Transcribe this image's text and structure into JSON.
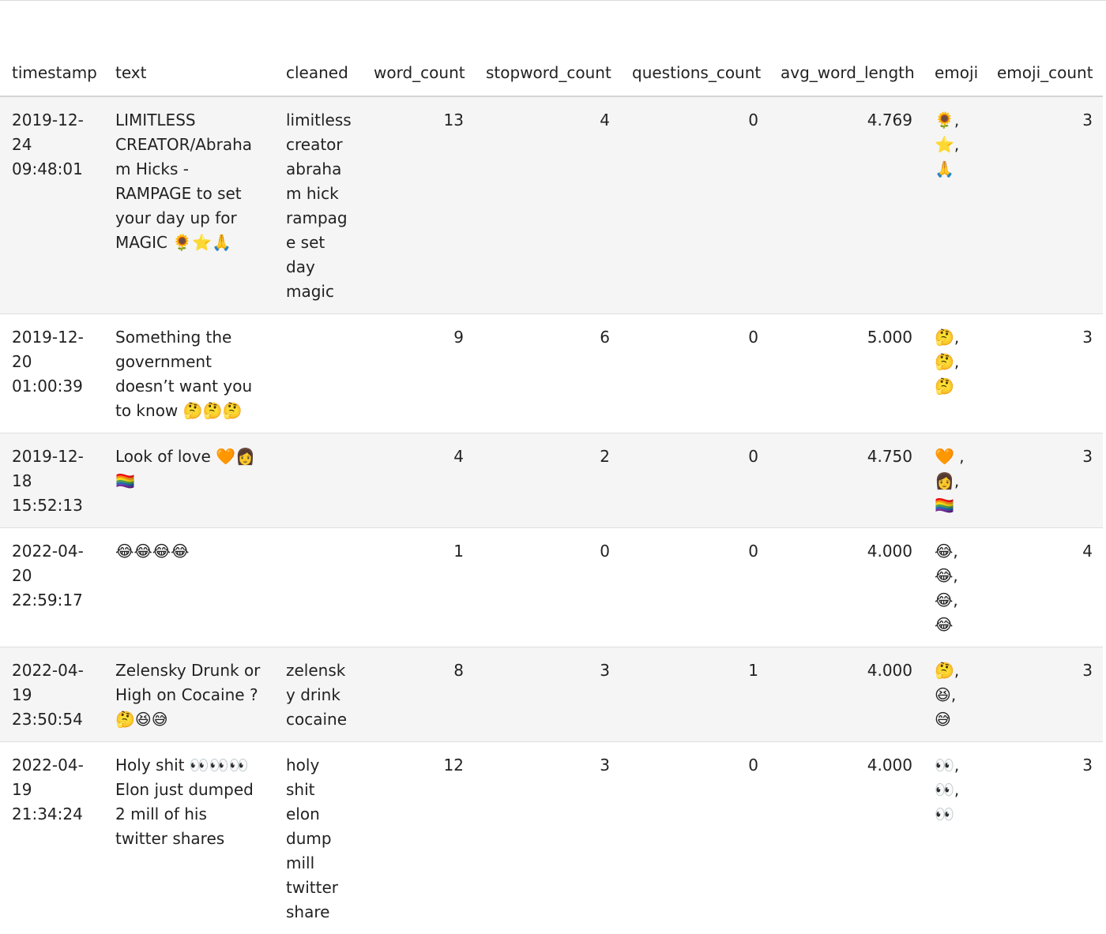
{
  "table": {
    "columns": [
      "timestamp",
      "text",
      "cleaned",
      "word_count",
      "stopword_count",
      "questions_count",
      "avg_word_length",
      "emoji",
      "emoji_count"
    ],
    "rows": [
      {
        "timestamp": "2019-12-24 09:48:01",
        "text": "LIMITLESS CREATOR/Abraham Hicks - RAMPAGE to set your day up for MAGIC 🌻⭐🙏",
        "cleaned": "limitless creator abraham hick rampage set day magic",
        "word_count": "13",
        "stopword_count": "4",
        "questions_count": "0",
        "avg_word_length": "4.769",
        "emoji": "🌻, ⭐, 🙏",
        "emoji_count": "3"
      },
      {
        "timestamp": "2019-12-20 01:00:39",
        "text": "Something the government doesn’t want you to know 🤔🤔🤔",
        "cleaned": "",
        "word_count": "9",
        "stopword_count": "6",
        "questions_count": "0",
        "avg_word_length": "5.000",
        "emoji": "🤔, 🤔, 🤔",
        "emoji_count": "3"
      },
      {
        "timestamp": "2019-12-18 15:52:13",
        "text": "Look of love 🧡👩🏳️‍🌈",
        "cleaned": "",
        "word_count": "4",
        "stopword_count": "2",
        "questions_count": "0",
        "avg_word_length": "4.750",
        "emoji": "🧡 , 👩, 🏳️‍🌈",
        "emoji_count": "3"
      },
      {
        "timestamp": "2022-04-20 22:59:17",
        "text": "😂😂😂😂",
        "cleaned": "",
        "word_count": "1",
        "stopword_count": "0",
        "questions_count": "0",
        "avg_word_length": "4.000",
        "emoji": "😂, 😂, 😂, 😂",
        "emoji_count": "4"
      },
      {
        "timestamp": "2022-04-19 23:50:54",
        "text": "Zelensky Drunk or High on Cocaine ? 🤔😆😅",
        "cleaned": "zelensky drink cocaine",
        "word_count": "8",
        "stopword_count": "3",
        "questions_count": "1",
        "avg_word_length": "4.000",
        "emoji": "🤔, 😆, 😅",
        "emoji_count": "3"
      },
      {
        "timestamp": "2022-04-19 21:34:24",
        "text": "Holy shit 👀👀👀 Elon just dumped 2 mill of his twitter shares",
        "cleaned": "holy shit elon dump mill twitter share",
        "word_count": "12",
        "stopword_count": "3",
        "questions_count": "0",
        "avg_word_length": "4.000",
        "emoji": "👀, 👀, 👀",
        "emoji_count": "3"
      }
    ]
  }
}
